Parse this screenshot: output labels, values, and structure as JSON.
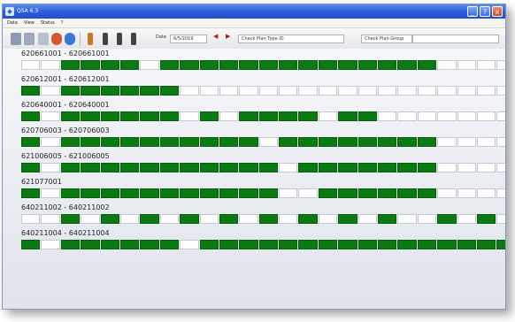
{
  "window": {
    "title": "QSA 6.3",
    "buttons": {
      "minimize": "_",
      "help": "?",
      "close": "x"
    }
  },
  "menu": [
    "Data",
    "View",
    "Status",
    "?"
  ],
  "toolbar": {
    "date_label": "Date",
    "date_value": "6/5/2019",
    "plan_type_label": "Check Plan Type ID",
    "plan_group_label": "Check Plan Group",
    "plan_group_value": ""
  },
  "colors": {
    "active_cell": "#0b7a12",
    "empty_cell": "#ffffff",
    "titlebar": "#2b5bd8"
  },
  "groups": [
    {
      "label": "620661001 - 620661001",
      "cells": [
        0,
        0,
        1,
        1,
        1,
        1,
        0,
        1,
        1,
        1,
        1,
        1,
        1,
        1,
        1,
        1,
        1,
        1,
        1,
        1,
        1,
        0,
        0,
        0,
        0
      ]
    },
    {
      "label": "620612001 - 620612001",
      "cells": [
        1,
        0,
        1,
        1,
        1,
        1,
        1,
        1,
        0,
        0,
        0,
        0,
        0,
        0,
        0,
        0,
        0,
        0,
        0,
        0,
        0,
        0,
        0,
        0,
        0
      ]
    },
    {
      "label": "620640001 - 620640001",
      "cells": [
        1,
        0,
        1,
        1,
        1,
        1,
        1,
        1,
        0,
        1,
        0,
        1,
        1,
        1,
        1,
        0,
        1,
        1,
        0,
        0,
        0,
        0,
        0,
        0,
        0
      ]
    },
    {
      "label": "620706003 - 620706003",
      "cells": [
        1,
        0,
        1,
        1,
        1,
        1,
        1,
        1,
        1,
        1,
        1,
        1,
        0,
        1,
        1,
        1,
        1,
        1,
        1,
        1,
        1,
        0,
        0,
        0,
        0
      ]
    },
    {
      "label": "621006005 - 621006005",
      "cells": [
        1,
        0,
        1,
        1,
        1,
        1,
        1,
        1,
        1,
        1,
        1,
        1,
        1,
        0,
        1,
        1,
        1,
        1,
        1,
        1,
        1,
        0,
        0,
        0,
        0
      ]
    },
    {
      "label": "621077001",
      "cells": [
        1,
        0,
        1,
        1,
        1,
        1,
        1,
        1,
        1,
        1,
        1,
        1,
        1,
        0,
        0,
        1,
        1,
        1,
        1,
        1,
        1,
        0,
        0,
        0,
        0
      ]
    },
    {
      "label": "640211002 - 640211002",
      "cells": [
        0,
        0,
        1,
        0,
        1,
        0,
        1,
        0,
        1,
        0,
        1,
        0,
        1,
        0,
        1,
        0,
        1,
        0,
        1,
        0,
        0,
        1,
        0,
        1,
        0
      ]
    },
    {
      "label": "640211004 - 640211004",
      "cells": [
        1,
        0,
        1,
        1,
        1,
        1,
        1,
        1,
        0,
        1,
        1,
        1,
        1,
        1,
        1,
        1,
        1,
        1,
        1,
        1,
        1,
        1,
        1,
        1,
        1
      ]
    }
  ]
}
